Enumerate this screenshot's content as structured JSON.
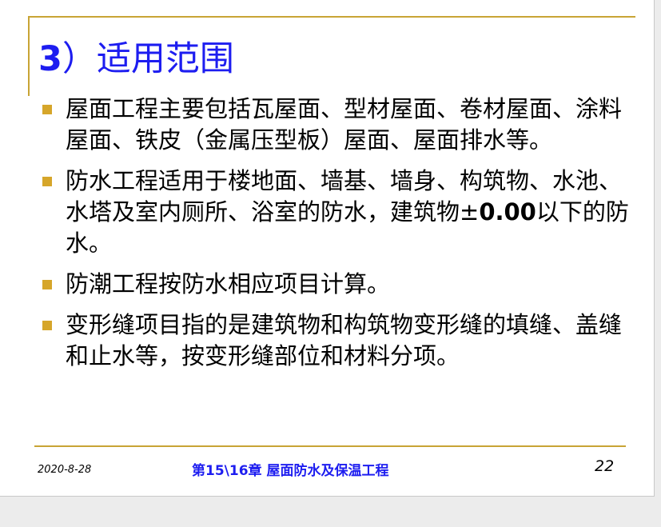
{
  "slide": {
    "title_number": "3",
    "title_text": "）适用范围",
    "bullets": [
      {
        "text": "屋面工程主要包括瓦屋面、型材屋面、卷材屋面、涂料屋面、铁皮（金属压型板）屋面、屋面排水等。"
      },
      {
        "text_a": "防水工程适用于楼地面、墙基、墙身、构筑物、水池、水塔及室内厕所、浴室的防水，建筑物±",
        "text_num": "0.00",
        "text_b": "以下的防水。"
      },
      {
        "text": "防潮工程按防水相应项目计算。"
      },
      {
        "text": "变形缝项目指的是建筑物和构筑物变形缝的填缝、盖缝和止水等，按变形缝部位和材料分项。"
      }
    ]
  },
  "footer": {
    "date": "2020-8-28",
    "chapter": "第15\\16章  屋面防水及保温工程",
    "page_number": "22"
  },
  "colors": {
    "accent": "#c8a435",
    "bullet": "#d6a62a",
    "title": "#1d1df0"
  }
}
